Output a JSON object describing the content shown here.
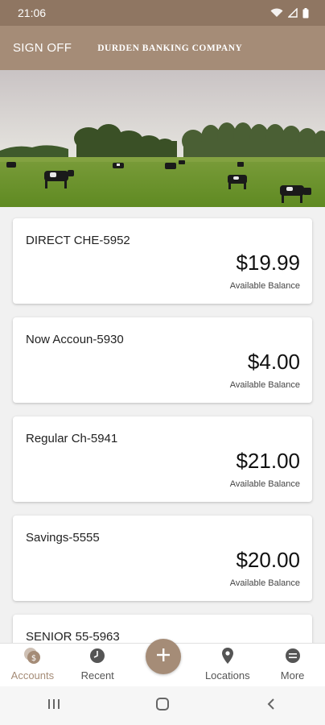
{
  "status": {
    "time": "21:06"
  },
  "header": {
    "sign_off": "SIGN OFF",
    "bank_name": "DURDEN BANKING COMPANY"
  },
  "accounts": [
    {
      "name": "DIRECT CHE-5952",
      "amount": "$19.99",
      "label": "Available Balance"
    },
    {
      "name": "Now Accoun-5930",
      "amount": "$4.00",
      "label": "Available Balance"
    },
    {
      "name": "Regular Ch-5941",
      "amount": "$21.00",
      "label": "Available Balance"
    },
    {
      "name": "Savings-5555",
      "amount": "$20.00",
      "label": "Available Balance"
    },
    {
      "name": "SENIOR 55-5963",
      "amount": "",
      "label": ""
    }
  ],
  "tabs": {
    "accounts": "Accounts",
    "recent": "Recent",
    "locations": "Locations",
    "more": "More"
  },
  "colors": {
    "brand": "#a58c77",
    "status_bar": "#8f7662"
  },
  "icons": [
    "wifi-icon",
    "signal-icon",
    "battery-icon",
    "accounts-icon",
    "recent-clock-icon",
    "plus-icon",
    "location-pin-icon",
    "more-icon",
    "recents-nav-icon",
    "home-nav-icon",
    "back-nav-icon"
  ]
}
